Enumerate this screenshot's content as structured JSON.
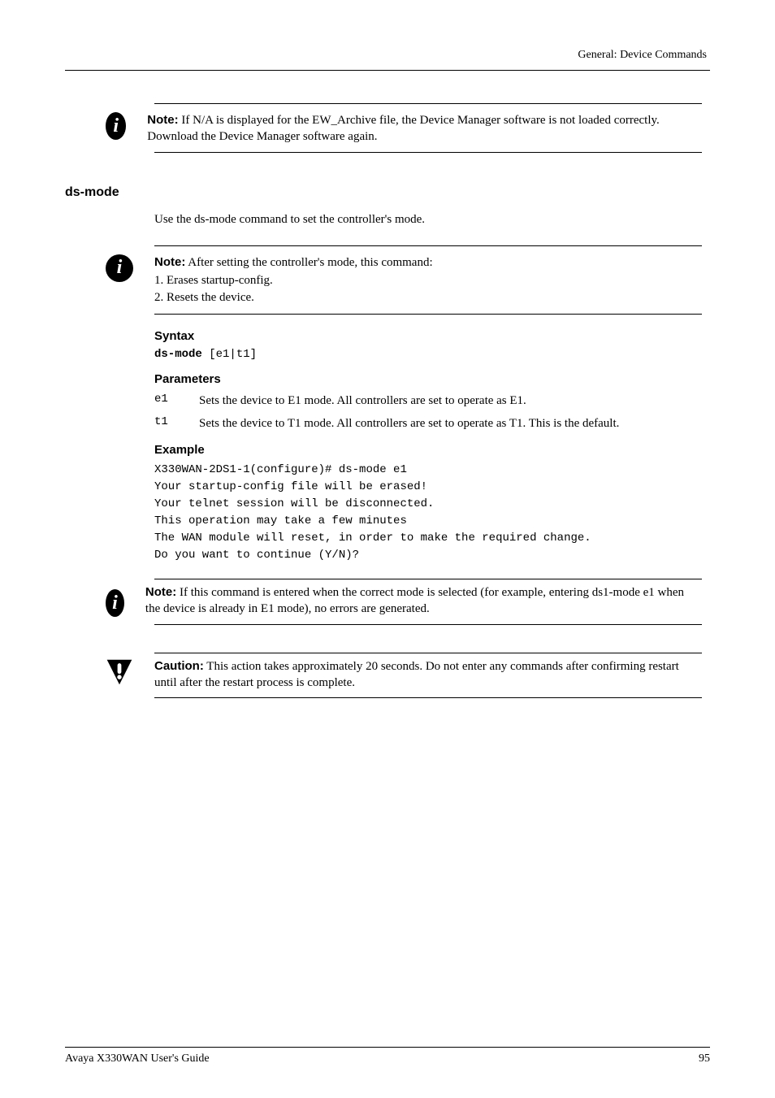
{
  "header": {
    "breadcrumb": "General: Device Commands"
  },
  "note1": {
    "label": "Note:",
    "body": "  If N/A  is displayed for the EW_Archive file, the Device Manager software is not loaded correctly. Download the Device Manager software again."
  },
  "section": {
    "title": "ds-mode",
    "intro": "Use the ds-mode command to set the controller's mode."
  },
  "note2": {
    "label": "Note:",
    "body": "  After setting the controller's mode, this command:",
    "li1": "1.  Erases startup-config.",
    "li2": "2.  Resets the device."
  },
  "syntax": {
    "head": "Syntax",
    "code_bold": "ds-mode",
    "code_rest": " [e1|t1]"
  },
  "params": {
    "head": "Parameters",
    "rows": [
      {
        "key": "e1",
        "val": "Sets the device to E1 mode. All controllers are set to operate as E1."
      },
      {
        "key": "t1",
        "val": "Sets the device to T1 mode. All controllers are set to operate as T1. This is the default."
      }
    ]
  },
  "example": {
    "head": "Example",
    "lines": "X330WAN-2DS1-1(configure)# ds-mode e1\nYour startup-config file will be erased!\nYour telnet session will be disconnected.\nThis operation may take a few minutes\nThe WAN module will reset, in order to make the required change.\nDo you want to continue (Y/N)?"
  },
  "note3": {
    "label": "Note:",
    "body": "  If this command is entered when the correct mode is selected (for example, entering ds1-mode e1 when the device is already in E1 mode), no errors are generated."
  },
  "caution": {
    "label": "Caution:",
    "body": "  This action takes approximately 20 seconds. Do not enter any commands after confirming restart until after the restart process is complete."
  },
  "footer": {
    "left": "Avaya X330WAN User's Guide",
    "right": "95"
  }
}
